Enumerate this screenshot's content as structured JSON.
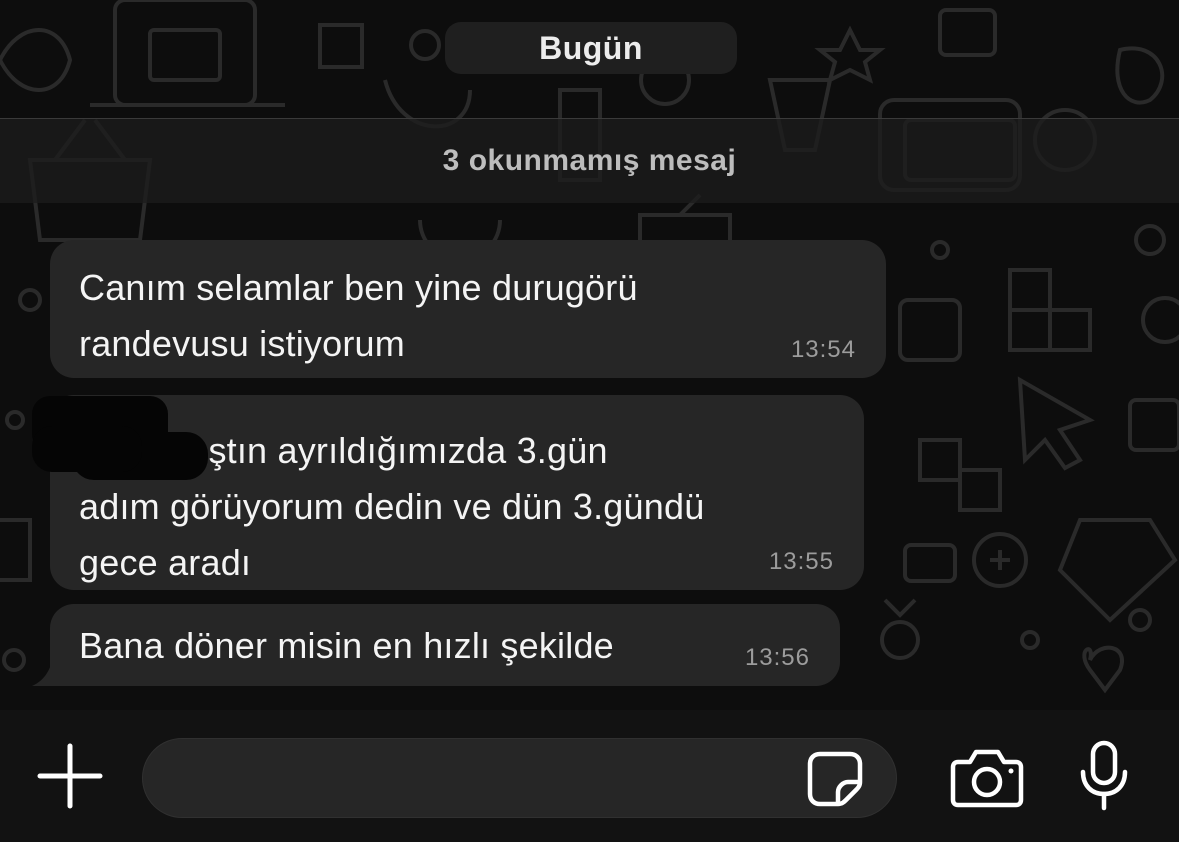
{
  "chat": {
    "date_label": "Bugün",
    "unread_label": "3 okunmamış mesaj",
    "messages": [
      {
        "text": "Canım selamlar ben yine durugörü\nrandevusu istiyorum",
        "time": "13:54"
      },
      {
        "text": "         e bakmıştın ayrıldığımızda 3.gün\nadım görüyorum dedin ve dün 3.gündü\ngece aradı",
        "time": "13:55"
      },
      {
        "text": "Bana döner misin en hızlı şekilde",
        "time": "13:56"
      }
    ]
  },
  "composer": {
    "placeholder": "",
    "icons": [
      "plus-icon",
      "sticker-icon",
      "camera-icon",
      "microphone-icon"
    ]
  },
  "colors": {
    "background": "#0d0d0d",
    "bubble": "#262626",
    "timestamp": "#9c9c9c",
    "input_bar": "#121212"
  }
}
